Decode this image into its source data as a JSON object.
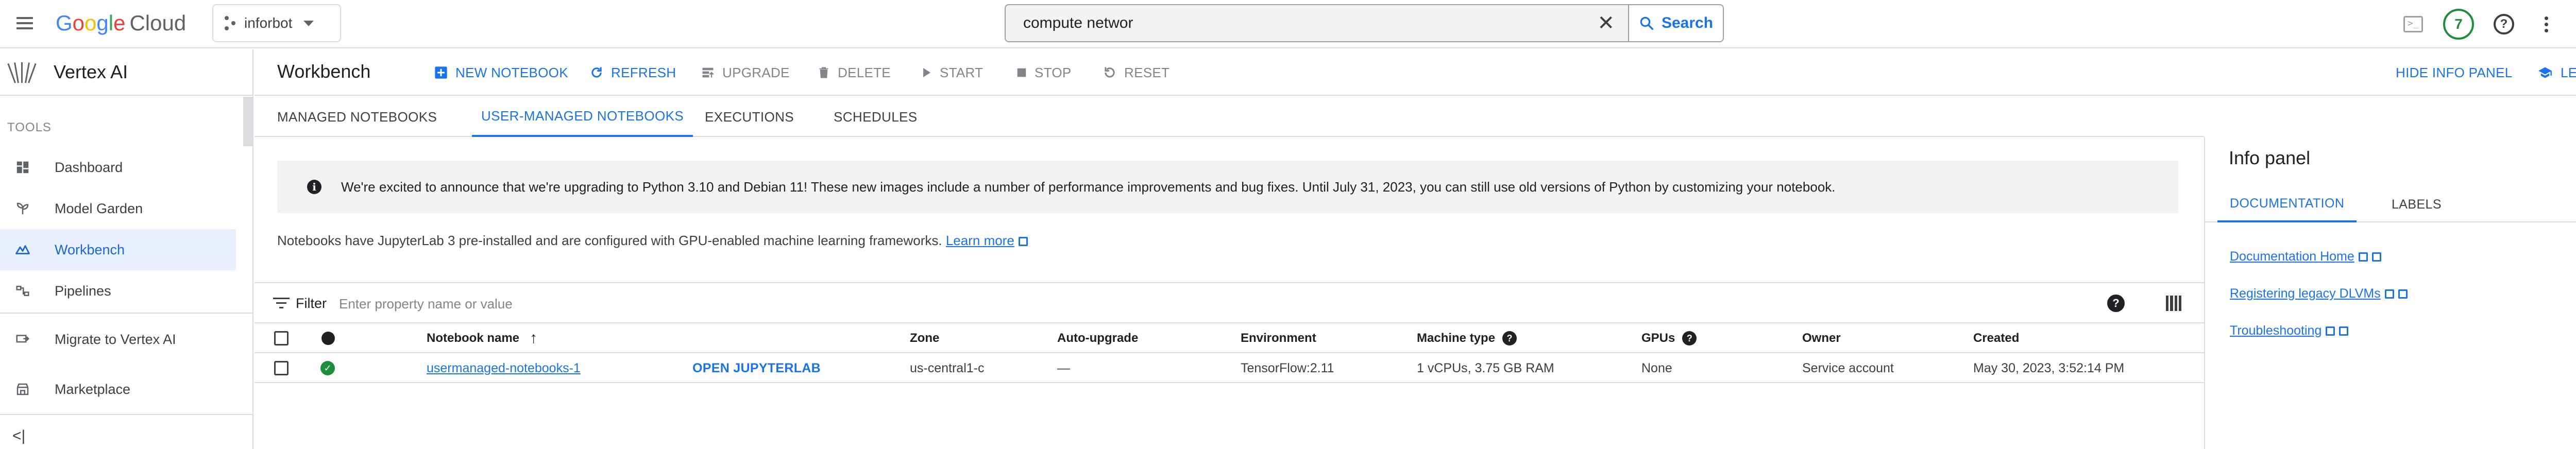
{
  "topbar": {
    "logo_google": [
      "G",
      "o",
      "o",
      "g",
      "l",
      "e"
    ],
    "logo_cloud": "Cloud",
    "project": "inforbot",
    "search_query": "compute networ",
    "search_button": "Search",
    "notification_count": "7"
  },
  "leftnav": {
    "title": "Vertex AI",
    "section_label": "TOOLS",
    "items": [
      {
        "label": "Dashboard",
        "icon": "dashboard-icon"
      },
      {
        "label": "Model Garden",
        "icon": "model-garden-icon"
      },
      {
        "label": "Workbench",
        "icon": "workbench-icon",
        "active": true
      },
      {
        "label": "Pipelines",
        "icon": "pipelines-icon"
      },
      {
        "label": "Migrate to Vertex AI",
        "icon": "migrate-icon"
      },
      {
        "label": "Marketplace",
        "icon": "marketplace-icon"
      }
    ],
    "collapse_glyph": "<|"
  },
  "toolbar": {
    "title": "Workbench",
    "new_notebook": "NEW NOTEBOOK",
    "refresh": "REFRESH",
    "upgrade": "UPGRADE",
    "delete": "DELETE",
    "start": "START",
    "stop": "STOP",
    "reset": "RESET",
    "hide_info_panel": "HIDE INFO PANEL",
    "learn": "LEARN"
  },
  "tabs": [
    "MANAGED NOTEBOOKS",
    "USER-MANAGED NOTEBOOKS",
    "EXECUTIONS",
    "SCHEDULES"
  ],
  "banner_text": "We're excited to announce that we're upgrading to Python 3.10 and Debian 11! These new images include a number of performance improvements and bug fixes. Until July 31, 2023, you can still use old versions of Python by customizing your notebook.",
  "subnote": {
    "text": "Notebooks have JupyterLab 3 pre-installed and are configured with GPU-enabled machine learning frameworks.",
    "link": "Learn more"
  },
  "filter": {
    "label": "Filter",
    "placeholder": "Enter property name or value"
  },
  "table": {
    "headers": {
      "name": "Notebook name",
      "zone": "Zone",
      "auto_upgrade": "Auto-upgrade",
      "environment": "Environment",
      "machine_type": "Machine type",
      "gpus": "GPUs",
      "owner": "Owner",
      "created": "Created"
    },
    "rows": [
      {
        "name": "usermanaged-notebooks-1",
        "open": "OPEN JUPYTERLAB",
        "zone": "us-central1-c",
        "auto_upgrade": "—",
        "environment": "TensorFlow:2.11",
        "machine_type": "1 vCPUs, 3.75 GB RAM",
        "gpus": "None",
        "owner": "Service account",
        "created": "May 30, 2023, 3:52:14 PM"
      }
    ]
  },
  "info_panel": {
    "title": "Info panel",
    "tabs": [
      "DOCUMENTATION",
      "LABELS"
    ],
    "links": [
      "Documentation Home",
      "Registering legacy DLVMs",
      "Troubleshooting"
    ]
  },
  "colors": {
    "accent": "#1a73e8",
    "status_green": "#1e8e3e",
    "active_nav_bg": "#e8f0fe"
  }
}
